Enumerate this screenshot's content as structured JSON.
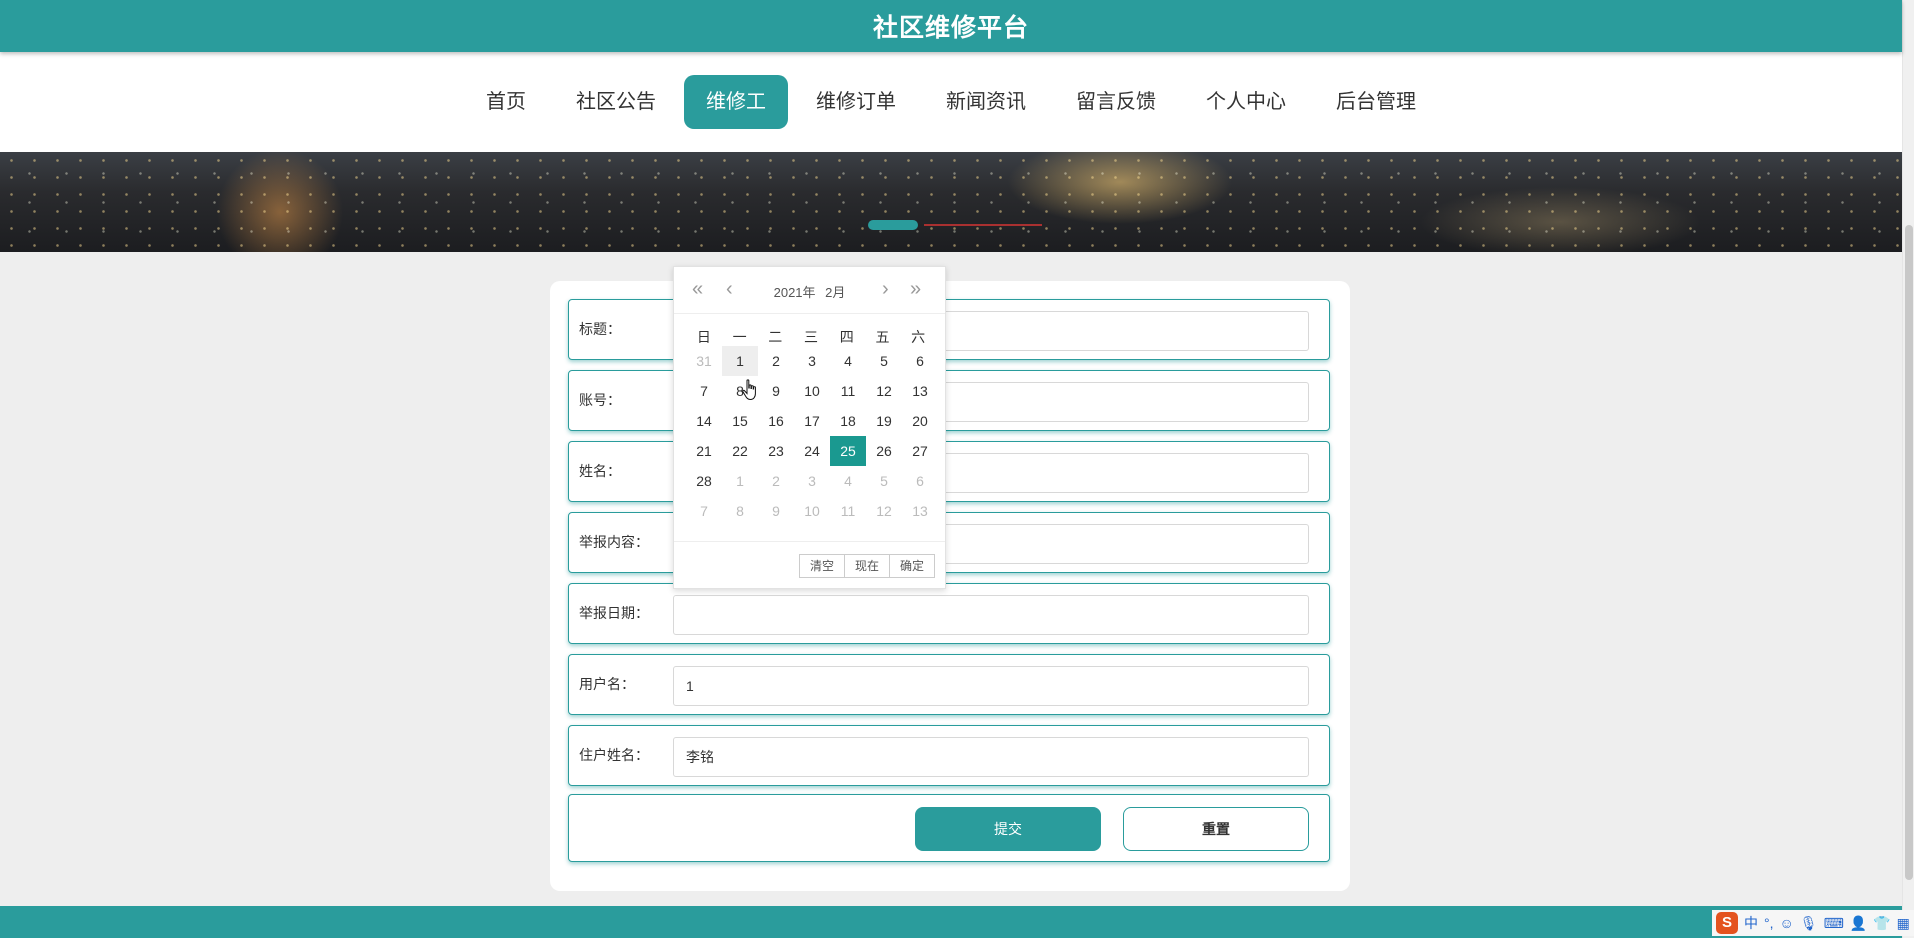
{
  "header": {
    "title": "社区维修平台"
  },
  "nav": {
    "items": [
      {
        "label": "首页"
      },
      {
        "label": "社区公告"
      },
      {
        "label": "维修工",
        "active": true
      },
      {
        "label": "维修订单"
      },
      {
        "label": "新闻资讯"
      },
      {
        "label": "留言反馈"
      },
      {
        "label": "个人中心"
      },
      {
        "label": "后台管理"
      }
    ]
  },
  "form": {
    "fields": [
      {
        "label": "标题：",
        "value": ""
      },
      {
        "label": "账号：",
        "value": ""
      },
      {
        "label": "姓名：",
        "value": ""
      },
      {
        "label": "举报内容：",
        "value": ""
      },
      {
        "label": "举报日期：",
        "value": ""
      },
      {
        "label": "用户名：",
        "value": "1"
      },
      {
        "label": "住户姓名：",
        "value": "李铭"
      }
    ],
    "submit_label": "提交",
    "reset_label": "重置"
  },
  "datepicker": {
    "year_label": "2021年",
    "month_label": "2月",
    "weekdays": [
      "日",
      "一",
      "二",
      "三",
      "四",
      "五",
      "六"
    ],
    "days": [
      "31",
      "1",
      "2",
      "3",
      "4",
      "5",
      "6",
      "7",
      "8",
      "9",
      "10",
      "11",
      "12",
      "13",
      "14",
      "15",
      "16",
      "17",
      "18",
      "19",
      "20",
      "21",
      "22",
      "23",
      "24",
      "25",
      "26",
      "27",
      "28",
      "1",
      "2",
      "3",
      "4",
      "5",
      "6",
      "7",
      "8",
      "9",
      "10",
      "11",
      "12",
      "13"
    ],
    "muted_indices": [
      0,
      29,
      30,
      31,
      32,
      33,
      34,
      35,
      36,
      37,
      38,
      39,
      40,
      41
    ],
    "selected_index": 25,
    "hover_index": 1,
    "buttons": {
      "clear": "清空",
      "now": "现在",
      "confirm": "确定"
    }
  },
  "colors": {
    "accent": "#2a9c9c",
    "selected_day": "#1a9990"
  },
  "ime": {
    "mode_label": "中",
    "punct_label": "°,"
  }
}
